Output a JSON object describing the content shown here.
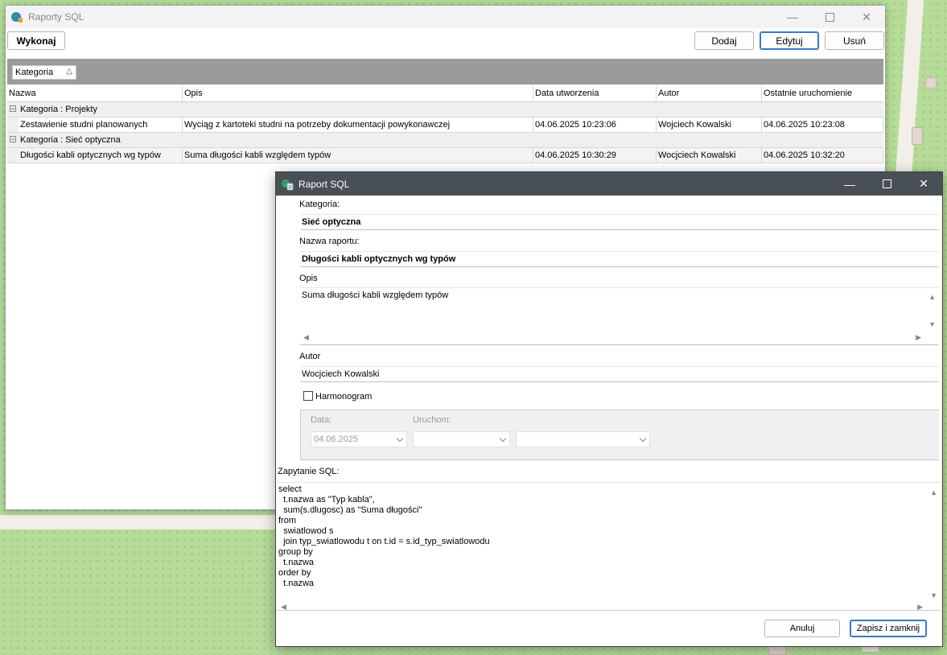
{
  "main_window": {
    "title": "Raporty SQL",
    "toolbar": {
      "execute_label": "Wykonaj",
      "add_label": "Dodaj",
      "edit_label": "Edytuj",
      "delete_label": "Usuń"
    },
    "group_by_chip": "Kategoria",
    "columns": [
      "Nazwa",
      "Opis",
      "Data utworzenia",
      "Autor",
      "Ostatnie uruchomienie"
    ],
    "groups": [
      {
        "label": "Kategoria : Projekty",
        "rows": [
          {
            "name": "Zestawienie studni planowanych",
            "description": "Wyciąg z kartoteki studni na potrzeby dokumentacji powykonawczej",
            "created": "04.06.2025 10:23:06",
            "author": "Wojciech Kowalski",
            "last_run": "04.06.2025 10:23:08"
          }
        ]
      },
      {
        "label": "Kategoria : Sieć optyczna",
        "rows": [
          {
            "name": "Długości kabli optycznych wg typów",
            "description": "Suma długości kabli względem typów",
            "created": "04.06.2025 10:30:29",
            "author": "Wocjciech Kowalski",
            "last_run": "04.06.2025 10:32:20"
          }
        ]
      }
    ]
  },
  "dialog": {
    "title": "Raport SQL",
    "category_label": "Kategoria:",
    "category_value": "Sieć optyczna",
    "report_name_label": "Nazwa raportu:",
    "report_name_value": "Długości kabli optycznych wg typów",
    "description_label": "Opis",
    "description_value": "Suma długości kabli względem typów",
    "author_label": "Autor",
    "author_value": "Wocjciech Kowalski",
    "schedule_checkbox_label": "Harmonogram",
    "schedule_checked": false,
    "date_label": "Data:",
    "date_value": "04.06.2025",
    "run_label": "Uruchom:",
    "run_value_1": "",
    "run_value_2": "",
    "sql_label": "Zapytanie SQL:",
    "sql_text": "select\n  t.nazwa as \"Typ kabla\",\n  sum(s.dlugosc) as \"Suma długości\"\nfrom\n  swiatlowod s\n  join typ_swiatlowodu t on t.id = s.id_typ_swiatlowodu\ngroup by\n  t.nazwa\norder by\n  t.nazwa",
    "cancel_label": "Anuluj",
    "save_close_label": "Zapisz i zamknij"
  }
}
